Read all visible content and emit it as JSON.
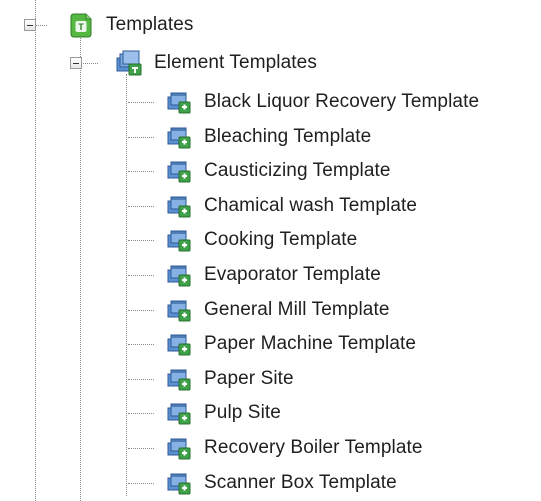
{
  "tree": {
    "root": {
      "label": "Templates",
      "icon": "template-folder-icon",
      "expanded": true
    },
    "group": {
      "label": "Element Templates",
      "icon": "element-templates-icon",
      "expanded": true
    },
    "items": [
      {
        "label": "Black Liquor Recovery Template",
        "icon": "element-template-icon"
      },
      {
        "label": "Bleaching Template",
        "icon": "element-template-icon"
      },
      {
        "label": "Causticizing Template",
        "icon": "element-template-icon"
      },
      {
        "label": "Chamical wash Template",
        "icon": "element-template-icon"
      },
      {
        "label": "Cooking Template",
        "icon": "element-template-icon"
      },
      {
        "label": "Evaporator Template",
        "icon": "element-template-icon"
      },
      {
        "label": "General Mill Template",
        "icon": "element-template-icon"
      },
      {
        "label": "Paper Machine Template",
        "icon": "element-template-icon"
      },
      {
        "label": "Paper Site",
        "icon": "element-template-icon"
      },
      {
        "label": "Pulp Site",
        "icon": "element-template-icon"
      },
      {
        "label": "Recovery Boiler Template",
        "icon": "element-template-icon"
      },
      {
        "label": "Scanner Box Template",
        "icon": "element-template-icon"
      }
    ],
    "colors": {
      "root_icon_green": "#4caf3a",
      "element_icon_blue": "#3a78c2",
      "element_icon_green": "#3fa24a",
      "connector_gray": "#8a8a8a"
    }
  }
}
